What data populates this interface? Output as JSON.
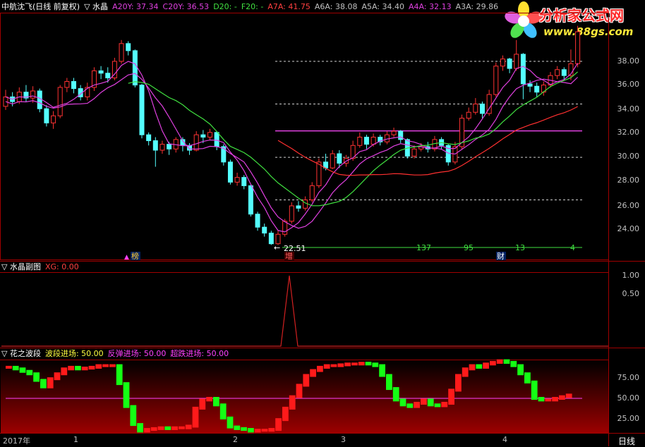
{
  "main_header": {
    "title": "中航沈飞(日线 前复权)",
    "indicator": "▽ 水晶",
    "items": [
      {
        "label": "A20Y: 37.34",
        "color": "#e040e0"
      },
      {
        "label": "C20Y: 36.53",
        "color": "#e040e0"
      },
      {
        "label": "D20: -",
        "color": "#40e040"
      },
      {
        "label": "F20: -",
        "color": "#40e040"
      },
      {
        "label": "A7A: 41.75",
        "color": "#ff4040"
      },
      {
        "label": "A6A: 38.08",
        "color": "#c0c0c0"
      },
      {
        "label": "A5A: 34.40",
        "color": "#c0c0c0"
      },
      {
        "label": "A4A: 32.13",
        "color": "#e040e0"
      },
      {
        "label": "A3A: 29.86",
        "color": "#c0c0c0"
      }
    ]
  },
  "logo": {
    "name": "分析家公式网",
    "url": "www.88gs.com"
  },
  "price_axis": [
    "38.00",
    "36.00",
    "34.00",
    "32.00",
    "30.00",
    "28.00",
    "26.00",
    "24.00"
  ],
  "price_annotations": {
    "low": "22.51",
    "counts": [
      "137",
      "95",
      "13",
      "4"
    ]
  },
  "markers": [
    {
      "text": "榜",
      "color": "#ffcc33"
    },
    {
      "text": "增",
      "color": "#ff6060"
    },
    {
      "text": "财",
      "color": "#ffffff"
    }
  ],
  "sub1": {
    "title": "▽ 水晶副图",
    "item": "XG: 0.00",
    "axis": [
      "1.00",
      "0.50"
    ]
  },
  "sub2": {
    "title": "▽ 花之波段",
    "items": [
      {
        "label": "波段进场: 50.00",
        "color": "#ffff40"
      },
      {
        "label": "反弹进场: 50.00",
        "color": "#ff40ff"
      },
      {
        "label": "超跌进场: 50.00",
        "color": "#ff40ff"
      }
    ],
    "axis": [
      "75.00",
      "50.00",
      "25.00"
    ]
  },
  "time_axis": {
    "labels": [
      "2017年",
      "1",
      "2",
      "3",
      "4"
    ],
    "period": "日线"
  },
  "colors": {
    "up": "#ff3232",
    "down": "#54ffff",
    "grid": "#a00000"
  }
}
